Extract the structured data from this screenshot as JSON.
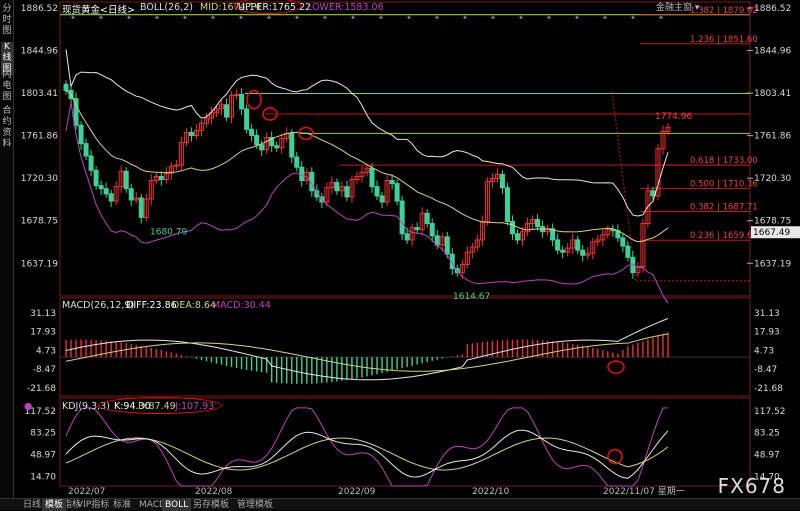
{
  "sidebar": {
    "tabs": [
      "分时图",
      "K线图",
      "闪电图",
      "合约资料"
    ]
  },
  "header": {
    "symbol": "现货黄金<日线>",
    "boll_label": "BOLL(26,2)",
    "mid": "MID:1674.14",
    "upper": "UPPER:1765.22",
    "lower": "LOWER:1583.06"
  },
  "top_right": "金融主窗 ▾",
  "macd_header": {
    "label": "MACD(26,12,9)",
    "diff": "DIFF:23.86",
    "dea": "DEA:8.64",
    "macd": "MACD:30.44"
  },
  "kdj_header": {
    "label": "KDJ(9,3,3)",
    "k": "K:94.30",
    "d": "D:87.49",
    "j": "J:107.93"
  },
  "bottom_tabs": [
    "日线 ▲",
    "指标",
    "模板",
    "VIP指标",
    "标准",
    "MACD",
    "BOLL",
    "另存模板",
    "管理模板"
  ],
  "watermark": "FX678",
  "colors": {
    "up": "#f03030",
    "down": "#3ad29a",
    "mid": "#d4d470",
    "upper_band": "#e6e6e6",
    "lower_band": "#c040c0",
    "fib_line": "#c01818",
    "green_line": "#9acd32"
  },
  "chart_data": [
    {
      "type": "candlestick",
      "panel": "price",
      "title": "现货黄金<日线>",
      "ylim": [
        1610,
        1890
      ],
      "y_ticks": [
        1886.52,
        1844.96,
        1803.41,
        1761.86,
        1720.3,
        1678.75,
        1637.19
      ],
      "x_labels": [
        "2022/07",
        "2022/08",
        "2022/09",
        "2022/10",
        "2022/11/07 星期一"
      ],
      "annotations": {
        "high_label": "1774.96",
        "low_label_1": "1680.79",
        "low_label_2": "1614.67",
        "right_value": "1667.49"
      },
      "fib_levels": [
        {
          "label": "1.382 | 1879.62",
          "value": 1879.62
        },
        {
          "label": "1.236 | 1851.60",
          "value": 1851.6
        },
        {
          "label": "0.618 | 1733.00",
          "value": 1733.0
        },
        {
          "label": "0.500 | 1710.36",
          "value": 1710.36
        },
        {
          "label": "0.382 | 1687.71",
          "value": 1687.71
        },
        {
          "label": "0.236 | 1659.69",
          "value": 1659.69
        }
      ],
      "horizontal_lines": [
        1880.0,
        1803.0,
        1783.0,
        1764.0,
        1733.0
      ],
      "closes": [
        1806,
        1798,
        1772,
        1754,
        1742,
        1728,
        1713,
        1710,
        1705,
        1698,
        1712,
        1727,
        1710,
        1699,
        1701,
        1682,
        1700,
        1718,
        1722,
        1719,
        1725,
        1732,
        1733,
        1755,
        1765,
        1762,
        1767,
        1774,
        1779,
        1784,
        1788,
        1792,
        1780,
        1801,
        1802,
        1788,
        1768,
        1762,
        1753,
        1748,
        1760,
        1752,
        1750,
        1759,
        1764,
        1741,
        1731,
        1718,
        1726,
        1708,
        1702,
        1697,
        1711,
        1716,
        1708,
        1712,
        1702,
        1719,
        1722,
        1726,
        1730,
        1712,
        1703,
        1697,
        1718,
        1715,
        1698,
        1666,
        1660,
        1672,
        1670,
        1686,
        1676,
        1664,
        1655,
        1663,
        1646,
        1632,
        1628,
        1636,
        1648,
        1653,
        1660,
        1678,
        1717,
        1720,
        1724,
        1711,
        1678,
        1666,
        1660,
        1668,
        1676,
        1680,
        1673,
        1668,
        1671,
        1660,
        1650,
        1648,
        1652,
        1660,
        1650,
        1645,
        1647,
        1658,
        1660,
        1665,
        1670,
        1669,
        1662,
        1654,
        1643,
        1628,
        1634,
        1676,
        1708,
        1703,
        1749,
        1766,
        1770
      ]
    },
    {
      "type": "bar+line",
      "panel": "macd",
      "title": "MACD(26,12,9)",
      "ylim": [
        -26,
        36
      ],
      "y_ticks": [
        31.13,
        17.93,
        4.73,
        -8.47,
        -21.68
      ],
      "diff_last": 23.86,
      "dea_last": 8.64,
      "macd_last": 30.44
    },
    {
      "type": "line",
      "panel": "kdj",
      "title": "KDJ(9,3,3)",
      "ylim": [
        0,
        125
      ],
      "y_ticks": [
        117.52,
        83.25,
        48.97,
        14.7
      ],
      "k_last": 94.3,
      "d_last": 87.49,
      "j_last": 107.93
    }
  ]
}
